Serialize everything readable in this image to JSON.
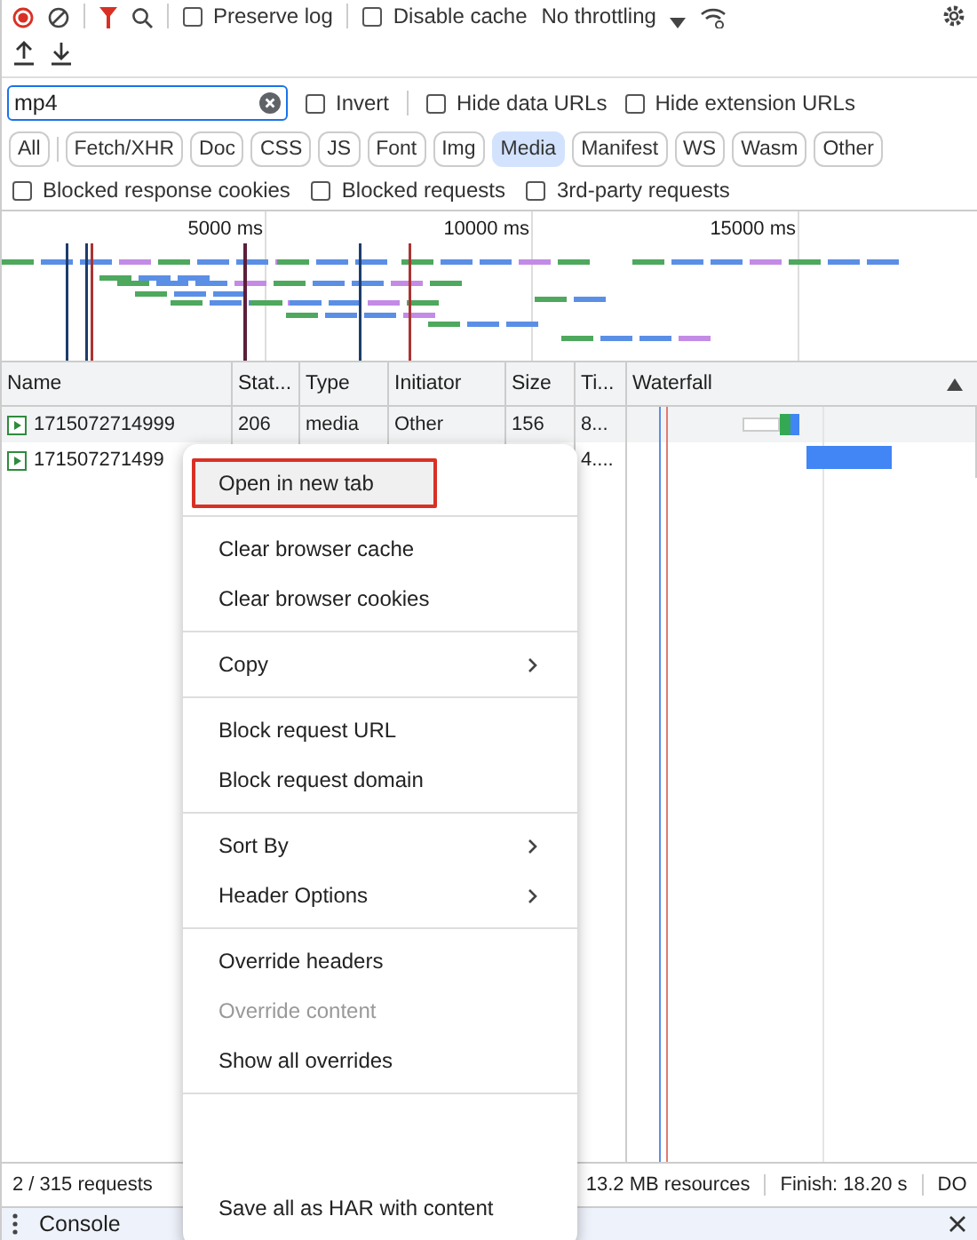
{
  "toolbar": {
    "preserve_log": {
      "label": "Preserve log",
      "checked": false
    },
    "disable_cache": {
      "label": "Disable cache",
      "checked": false
    },
    "throttling": "No throttling"
  },
  "filter": {
    "value": "mp4",
    "options": [
      {
        "label": "Invert",
        "checked": false
      },
      {
        "label": "Hide data URLs",
        "checked": false
      },
      {
        "label": "Hide extension URLs",
        "checked": false
      }
    ]
  },
  "type_filters": [
    {
      "label": "All",
      "selected": false
    },
    {
      "label": "Fetch/XHR",
      "selected": false
    },
    {
      "label": "Doc",
      "selected": false
    },
    {
      "label": "CSS",
      "selected": false
    },
    {
      "label": "JS",
      "selected": false
    },
    {
      "label": "Font",
      "selected": false
    },
    {
      "label": "Img",
      "selected": false
    },
    {
      "label": "Media",
      "selected": true
    },
    {
      "label": "Manifest",
      "selected": false
    },
    {
      "label": "WS",
      "selected": false
    },
    {
      "label": "Wasm",
      "selected": false
    },
    {
      "label": "Other",
      "selected": false
    }
  ],
  "extra_filters": [
    {
      "label": "Blocked response cookies",
      "checked": false
    },
    {
      "label": "Blocked requests",
      "checked": false
    },
    {
      "label": "3rd-party requests",
      "checked": false
    }
  ],
  "overview": {
    "ticks": [
      "5000 ms",
      "10000 ms",
      "15000 ms"
    ]
  },
  "table": {
    "columns": [
      "Name",
      "Stat...",
      "Type",
      "Initiator",
      "Size",
      "Ti...",
      "Waterfall"
    ],
    "rows": [
      {
        "cells": [
          "1715072714999",
          "206",
          "media",
          "Other",
          "156",
          "8..."
        ],
        "selected": true
      },
      {
        "cells": [
          "171507271499",
          "",
          "",
          "",
          "",
          "4...."
        ],
        "selected": false
      }
    ]
  },
  "status_bar": [
    "2 / 315 requests",
    "13.2 MB resources",
    "Finish: 18.20 s",
    "DO"
  ],
  "drawer": {
    "tabs": [
      "Console"
    ]
  },
  "context_menu": {
    "groups": [
      [
        {
          "label": "Open in new tab",
          "highlighted": true,
          "disabled": false,
          "submenu": false
        }
      ],
      [
        {
          "label": "Clear browser cache",
          "highlighted": false,
          "disabled": false,
          "submenu": false
        },
        {
          "label": "Clear browser cookies",
          "highlighted": false,
          "disabled": false,
          "submenu": false
        }
      ],
      [
        {
          "label": "Copy",
          "highlighted": false,
          "disabled": false,
          "submenu": true
        }
      ],
      [
        {
          "label": "Block request URL",
          "highlighted": false,
          "disabled": false,
          "submenu": false
        },
        {
          "label": "Block request domain",
          "highlighted": false,
          "disabled": false,
          "submenu": false
        }
      ],
      [
        {
          "label": "Sort By",
          "highlighted": false,
          "disabled": false,
          "submenu": true
        },
        {
          "label": "Header Options",
          "highlighted": false,
          "disabled": false,
          "submenu": true
        }
      ],
      [
        {
          "label": "Override headers",
          "highlighted": false,
          "disabled": false,
          "submenu": false
        },
        {
          "label": "Override content",
          "highlighted": false,
          "disabled": true,
          "submenu": false
        },
        {
          "label": "Show all overrides",
          "highlighted": false,
          "disabled": false,
          "submenu": false
        }
      ],
      [
        {
          "label": "Save all as HAR with content",
          "highlighted": false,
          "disabled": false,
          "submenu": false
        }
      ]
    ]
  }
}
